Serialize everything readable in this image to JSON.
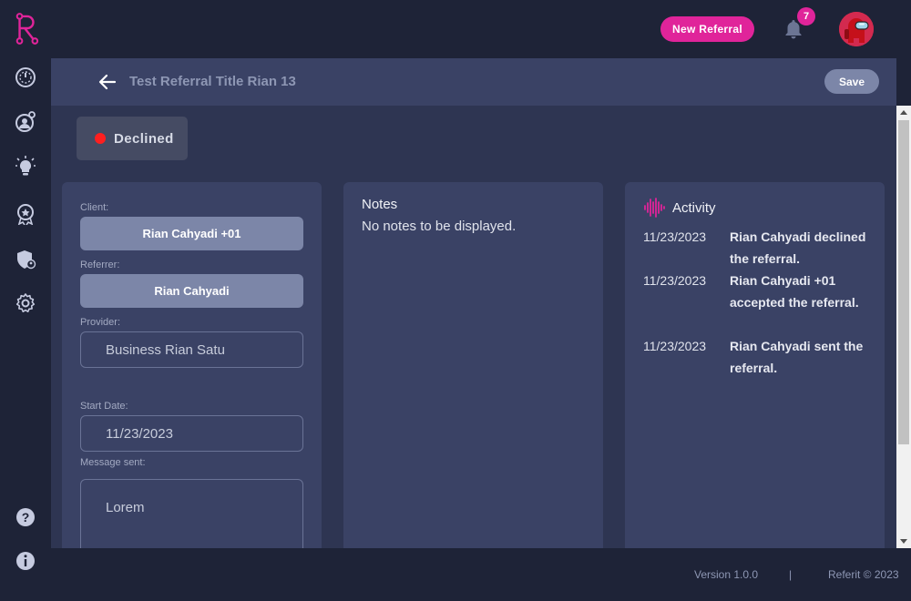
{
  "topbar": {
    "new_referral_label": "New Referral",
    "notification_count": "7",
    "brand_color": "#e0249a"
  },
  "sidebar": {
    "items": [
      {
        "icon": "dashboard-icon"
      },
      {
        "icon": "user-referral-icon"
      },
      {
        "icon": "lightbulb-icon"
      },
      {
        "icon": "award-icon"
      },
      {
        "icon": "shield-user-icon"
      },
      {
        "icon": "gear-icon"
      }
    ],
    "bottom_items": [
      {
        "icon": "help-icon"
      },
      {
        "icon": "info-icon"
      }
    ]
  },
  "header": {
    "title": "Test Referral Title Rian 13",
    "save_label": "Save"
  },
  "status": {
    "label": "Declined",
    "color": "#ff1f1f"
  },
  "details": {
    "client_label": "Client:",
    "client_value": "Rian Cahyadi +01",
    "referrer_label": "Referrer:",
    "referrer_value": "Rian Cahyadi",
    "provider_label": "Provider:",
    "provider_value": "Business Rian Satu",
    "start_date_label": "Start Date:",
    "start_date_value": "11/23/2023",
    "message_label": "Message sent:",
    "message_value": "Lorem"
  },
  "notes": {
    "title": "Notes",
    "empty_text": "No notes to be displayed."
  },
  "activity": {
    "title": "Activity",
    "items": [
      {
        "date": "11/23/2023",
        "text": "Rian Cahyadi declined the referral."
      },
      {
        "date": "11/23/2023",
        "text": "Rian Cahyadi +01 accepted the referral."
      },
      {
        "date": "11/23/2023",
        "text": "Rian Cahyadi sent the referral."
      }
    ]
  },
  "footer": {
    "version": "Version 1.0.0",
    "separator": "|",
    "copyright": "Referit © 2023"
  }
}
